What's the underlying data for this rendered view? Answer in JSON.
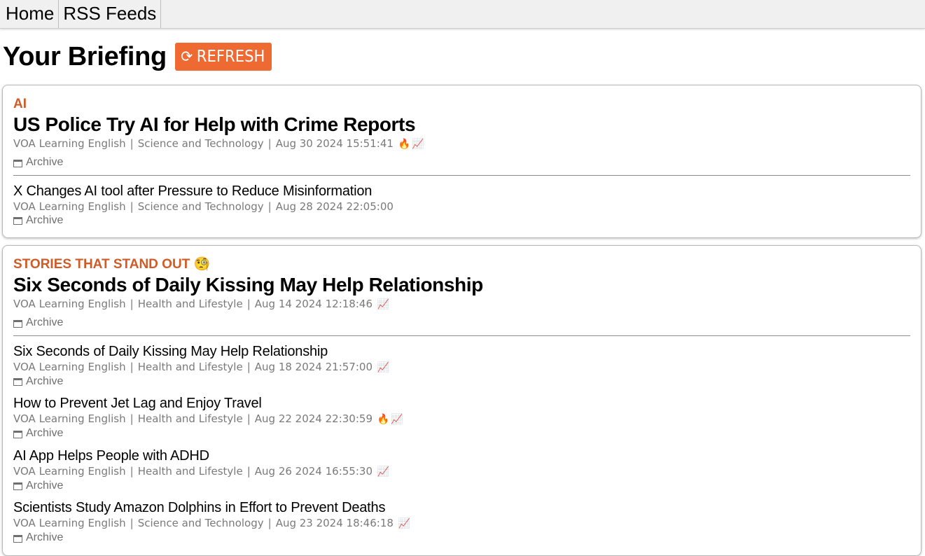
{
  "nav": {
    "home": "Home",
    "rss": "RSS Feeds"
  },
  "header": {
    "title": "Your Briefing",
    "refresh_icon": "⟳",
    "refresh_label": "REFRESH"
  },
  "icons": {
    "fire": "🔥",
    "trend": "📈",
    "monocle": "🧐"
  },
  "colors": {
    "accent": "#ef6a33",
    "topic": "#d15b27"
  },
  "sections": [
    {
      "topic": "AI",
      "lead": {
        "title": "US Police Try AI for Help with Crime Reports",
        "source": "VOA Learning English",
        "category": "Science and Technology",
        "date": "Aug 30 2024 15:51:41",
        "archive": "Archive"
      },
      "items": [
        {
          "title": "X Changes AI tool after Pressure to Reduce Misinformation",
          "source": "VOA Learning English",
          "category": "Science and Technology",
          "date": "Aug 28 2024 22:05:00",
          "archive": "Archive"
        }
      ]
    },
    {
      "topic": "STORIES THAT STAND OUT",
      "lead": {
        "title": "Six Seconds of Daily Kissing May Help Relationship",
        "source": "VOA Learning English",
        "category": "Health and Lifestyle",
        "date": "Aug 14 2024 12:18:46",
        "archive": "Archive"
      },
      "items": [
        {
          "title": "Six Seconds of Daily Kissing May Help Relationship",
          "source": "VOA Learning English",
          "category": "Health and Lifestyle",
          "date": "Aug 18 2024 21:57:00",
          "archive": "Archive"
        },
        {
          "title": "How to Prevent Jet Lag and Enjoy Travel",
          "source": "VOA Learning English",
          "category": "Health and Lifestyle",
          "date": "Aug 22 2024 22:30:59",
          "archive": "Archive"
        },
        {
          "title": "AI App Helps People with ADHD",
          "source": "VOA Learning English",
          "category": "Health and Lifestyle",
          "date": "Aug 26 2024 16:55:30",
          "archive": "Archive"
        },
        {
          "title": "Scientists Study Amazon Dolphins in Effort to Prevent Deaths",
          "source": "VOA Learning English",
          "category": "Science and Technology",
          "date": "Aug 23 2024 18:46:18",
          "archive": "Archive"
        }
      ]
    }
  ]
}
